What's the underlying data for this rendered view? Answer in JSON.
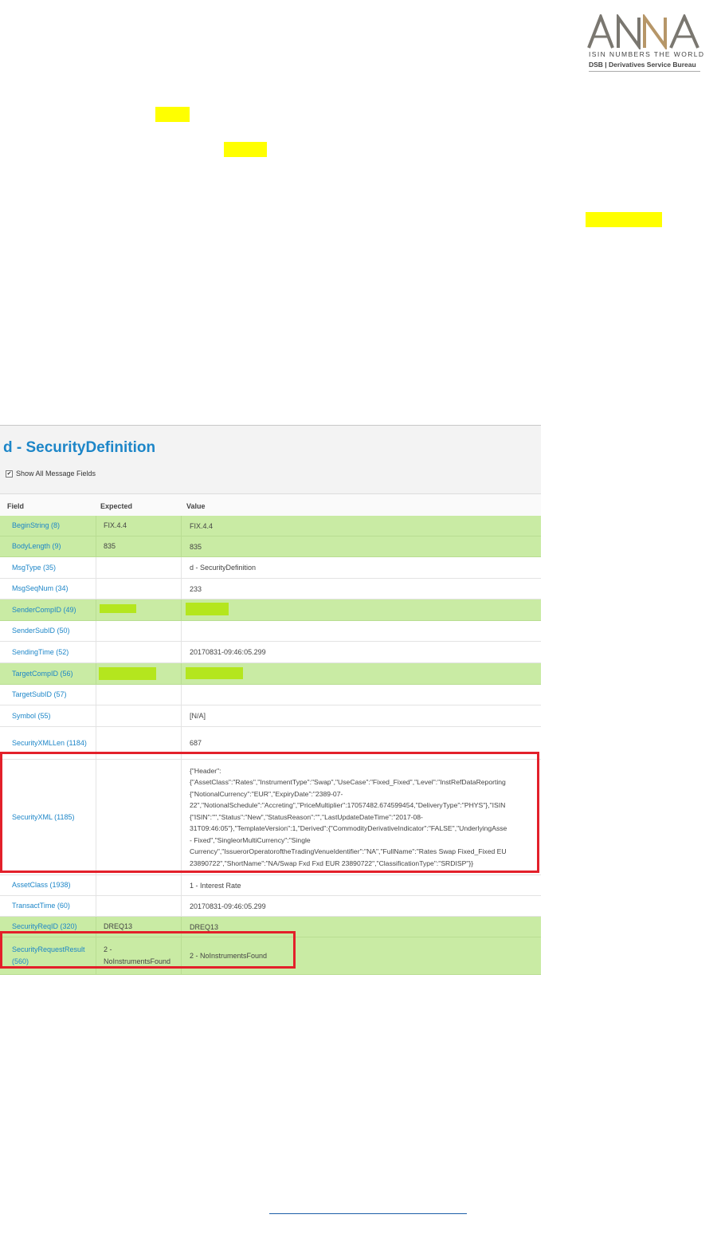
{
  "logo": {
    "word": "ANNA",
    "tagline": "ISIN NUMBERS THE WORLD",
    "subtitle": "DSB | Derivatives Service Bureau",
    "colors": {
      "gray": "#7a7770",
      "gold": "#b69668"
    }
  },
  "panel": {
    "title": "d - SecurityDefinition",
    "show_all_label": "Show All Message Fields",
    "show_all_checked": true,
    "columns": [
      "Field",
      "Expected",
      "Value"
    ]
  },
  "rows": [
    {
      "field": "BeginString (8)",
      "expected": "FIX.4.4",
      "value": "FIX.4.4",
      "green": true
    },
    {
      "field": "BodyLength (9)",
      "expected": "835",
      "value": "835",
      "green": true
    },
    {
      "field": "MsgType (35)",
      "expected": "",
      "value": "d - SecurityDefinition",
      "green": false
    },
    {
      "field": "MsgSeqNum (34)",
      "expected": "",
      "value": "233",
      "green": false
    },
    {
      "field": "SenderCompID (49)",
      "expected": "",
      "value": "",
      "green": true
    },
    {
      "field": "SenderSubID (50)",
      "expected": "",
      "value": "",
      "green": false
    },
    {
      "field": "SendingTime (52)",
      "expected": "",
      "value": "20170831-09:46:05.299",
      "green": false
    },
    {
      "field": "TargetCompID (56)",
      "expected": "",
      "value": "",
      "green": true
    },
    {
      "field": "TargetSubID (57)",
      "expected": "",
      "value": "",
      "green": false
    },
    {
      "field": "Symbol (55)",
      "expected": "",
      "value": "[N/A]",
      "green": false
    },
    {
      "field": "SecurityXMLLen (1184)",
      "expected": "",
      "value": "687",
      "green": false
    },
    {
      "field": "SecurityXML (1185)",
      "expected": "",
      "value": "{\"Header\":\n{\"AssetClass\":\"Rates\",\"InstrumentType\":\"Swap\",\"UseCase\":\"Fixed_Fixed\",\"Level\":\"InstRefDataReporting\n{\"NotionalCurrency\":\"EUR\",\"ExpiryDate\":\"2389-07-\n22\",\"NotionalSchedule\":\"Accreting\",\"PriceMultiplier\":17057482.674599454,\"DeliveryType\":\"PHYS\"},\"ISIN\n{\"ISIN\":\"\",\"Status\":\"New\",\"StatusReason\":\"\",\"LastUpdateDateTime\":\"2017-08-\n31T09:46:05\"},\"TemplateVersion\":1,\"Derived\":{\"CommodityDerivativeIndicator\":\"FALSE\",\"UnderlyingAsse\n- Fixed\",\"SingleorMultiCurrency\":\"Single\nCurrency\",\"IssuerorOperatoroftheTradingVenueIdentifier\":\"NA\",\"FullName\":\"Rates Swap Fixed_Fixed EU\n23890722\",\"ShortName\":\"NA/Swap Fxd Fxd EUR 23890722\",\"ClassificationType\":\"SRDISP\"}}",
      "green": false
    },
    {
      "field": "AssetClass (1938)",
      "expected": "",
      "value": "1 - Interest Rate",
      "green": false
    },
    {
      "field": "TransactTime (60)",
      "expected": "",
      "value": "20170831-09:46:05.299",
      "green": false
    },
    {
      "field": "SecurityReqID (320)",
      "expected": "DREQ13",
      "value": "DREQ13",
      "green": true
    },
    {
      "field": "SecurityRequestResult (560)",
      "expected": "2 - NoInstrumentsFound",
      "value": "2 - NoInstrumentsFound",
      "green": true
    }
  ]
}
